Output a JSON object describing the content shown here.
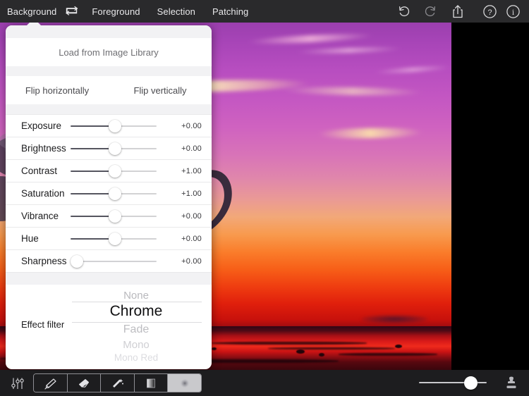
{
  "app": {
    "topbar": {
      "tabs": [
        {
          "id": "background",
          "label": "Background",
          "selected": true
        },
        {
          "id": "foreground",
          "label": "Foreground",
          "selected": false
        },
        {
          "id": "selection",
          "label": "Selection",
          "selected": false
        },
        {
          "id": "patching",
          "label": "Patching",
          "selected": false
        }
      ],
      "swap_icon": "swap-layers-icon",
      "actions": [
        {
          "id": "undo",
          "icon": "undo-icon"
        },
        {
          "id": "redo",
          "icon": "redo-icon"
        },
        {
          "id": "share",
          "icon": "share-icon"
        },
        {
          "id": "help",
          "icon": "help-icon"
        },
        {
          "id": "info",
          "icon": "info-icon"
        }
      ]
    },
    "panel": {
      "load_button": "Load from Image Library",
      "flip_horizontal": "Flip horizontally",
      "flip_vertical": "Flip vertically",
      "sliders": [
        {
          "label": "Exposure",
          "value": "+0.00",
          "pos": 54
        },
        {
          "label": "Brightness",
          "value": "+0.00",
          "pos": 54
        },
        {
          "label": "Contrast",
          "value": "+1.00",
          "pos": 54
        },
        {
          "label": "Saturation",
          "value": "+1.00",
          "pos": 54
        },
        {
          "label": "Vibrance",
          "value": "+0.00",
          "pos": 54
        },
        {
          "label": "Hue",
          "value": "+0.00",
          "pos": 54
        },
        {
          "label": "Sharpness",
          "value": "+0.00",
          "pos": 0
        }
      ],
      "effect_filter": {
        "label": "Effect filter",
        "selected": "Chrome",
        "options": [
          "None",
          "Chrome",
          "Fade",
          "Mono",
          "Mono Red"
        ]
      }
    },
    "bottombar": {
      "adjust_icon": "adjustments-sliders-icon",
      "tools": [
        {
          "id": "brush",
          "icon": "brush-icon",
          "selected": false
        },
        {
          "id": "eraser",
          "icon": "eraser-icon",
          "selected": false
        },
        {
          "id": "wand",
          "icon": "magic-wand-icon",
          "selected": false
        },
        {
          "id": "gradient",
          "icon": "gradient-icon",
          "selected": false
        },
        {
          "id": "soften",
          "icon": "soft-brush-icon",
          "selected": true
        }
      ],
      "size_slider": {
        "name": "brush-size-slider",
        "pos": 64
      },
      "stamp_icon": "stamp-icon"
    },
    "colors": {
      "topbar_bg": "#2a2a2c",
      "bottombar_bg": "#1d1d1f",
      "panel_bg": "#ffffff",
      "panel_gap": "#f2f2f4",
      "slider_active": "#55555f",
      "slider_inactive": "#d2d2d4",
      "segment_active": "#c9c9cc",
      "canvas_bg": "#000000"
    },
    "photo": {
      "name": "sunset-tree-photo",
      "description": "Purple-to-red sunset sky over a shoreline with a silhouetted tree on the left"
    }
  }
}
